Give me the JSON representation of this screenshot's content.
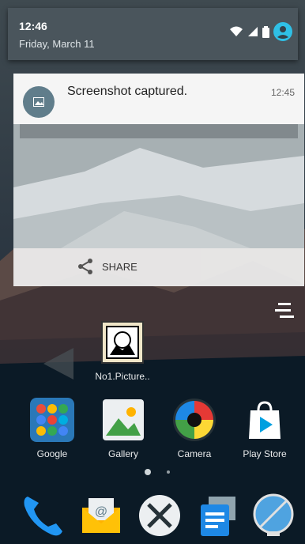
{
  "status": {
    "time": "12:46",
    "date": "Friday, March 11"
  },
  "notification": {
    "title": "Screenshot captured.",
    "time": "12:45",
    "action_label": "SHARE",
    "icon": "image-icon"
  },
  "home": {
    "folder_item_label": "No1.Picture..",
    "apps": [
      {
        "label": "Google",
        "icon": "google-folder-icon"
      },
      {
        "label": "Gallery",
        "icon": "gallery-icon"
      },
      {
        "label": "Camera",
        "icon": "camera-icon"
      },
      {
        "label": "Play Store",
        "icon": "play-store-icon"
      }
    ],
    "page_indicator": {
      "pages": 2,
      "current": 1
    }
  },
  "dock": [
    {
      "icon": "phone-icon"
    },
    {
      "icon": "email-icon"
    },
    {
      "icon": "launcher-icon"
    },
    {
      "icon": "messaging-icon"
    },
    {
      "icon": "browser-icon"
    }
  ],
  "colors": {
    "header": "#4a555c",
    "notif_icon": "#607d8b",
    "accent": "#2fc0e6"
  }
}
